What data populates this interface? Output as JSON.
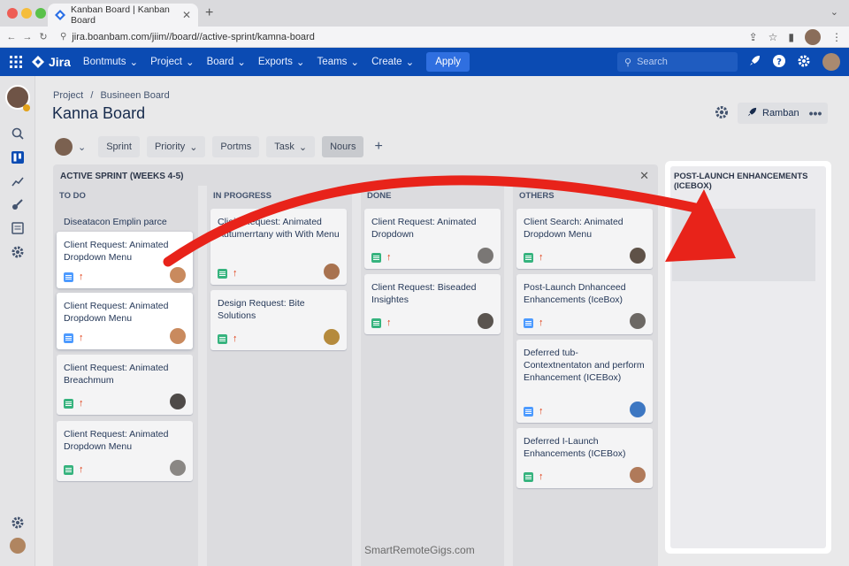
{
  "browser": {
    "tab_title": "Kanban Board | Kanban Board",
    "url": "jira.boanbam.com/jiim//board//active-sprint/kamna-board"
  },
  "topnav": {
    "brand": "Jira",
    "items": [
      "Bontmuts",
      "Project",
      "Board",
      "Exports",
      "Teams",
      "Create"
    ],
    "apply_label": "Apply",
    "search_placeholder": "Search"
  },
  "header": {
    "breadcrumb_root": "Project",
    "breadcrumb_sep": "/",
    "breadcrumb_child": "Busineen Board",
    "title": "Kanna Board",
    "action_label": "Ramban",
    "more_label": "•••"
  },
  "filters": {
    "items": [
      "Sprint",
      "Priority",
      "Portms",
      "Task",
      "Nours"
    ],
    "add_label": "+"
  },
  "sprint": {
    "title": "ACTIVE SPRINT (WEEKS 4-5)",
    "columns": [
      {
        "name": "TO DO",
        "header_card": "Diseatacon Emplin parce",
        "cards": [
          {
            "title": "Client Request: Animated Dropdown Menu"
          },
          {
            "title": "Client Request: Animated Dropdown Menu"
          },
          {
            "title": "Client Request: Animated Breachmum"
          },
          {
            "title": "Client Request: Animated Dropdown Menu"
          }
        ]
      },
      {
        "name": "IN PROGRESS",
        "cards": [
          {
            "title": "Cliein Request: Animated Autumerrtany with With Menu"
          },
          {
            "title": "Design Request: Bite Solutions"
          }
        ]
      },
      {
        "name": "DONE",
        "cards": [
          {
            "title": "Client Request: Animated Dropdown"
          },
          {
            "title": "Client Request: Biseaded Insightes"
          }
        ]
      },
      {
        "name": "OTHERS",
        "cards": [
          {
            "title": "Client Search: Animated Dropdown Menu"
          },
          {
            "title": "Post-Launch Dnhanceed Enhancements (IceBox)"
          },
          {
            "title": "Deferred tub-Contextnentaton and perform Enhancement (ICEBox)"
          },
          {
            "title": "Deferred I-Launch Enhancements (ICEBox)"
          }
        ]
      }
    ]
  },
  "icebox": {
    "title": "POST-LAUNCH ENHANCEMENTS (ICEBOX)"
  },
  "watermark": "SmartRemoteGigs.com",
  "colors": {
    "nav_blue": "#0b4bb3",
    "arrow_red": "#e8231a",
    "story_green": "#36b37e",
    "priority_red": "#de350b"
  }
}
